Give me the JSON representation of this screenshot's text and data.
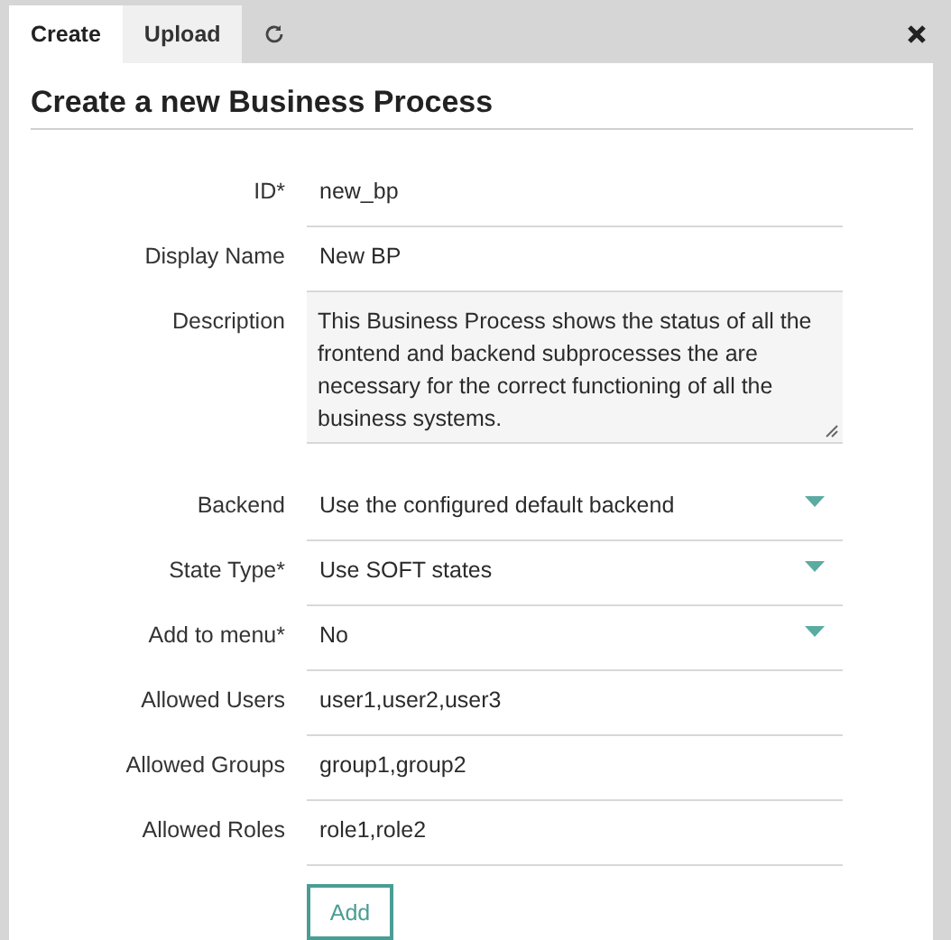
{
  "tabs": [
    {
      "label": "Create",
      "selected": true
    },
    {
      "label": "Upload",
      "selected": false
    }
  ],
  "heading": "Create a new Business Process",
  "fields": [
    {
      "kind": "text",
      "label": "ID*",
      "value": "new_bp"
    },
    {
      "kind": "text",
      "label": "Display Name",
      "value": "New BP"
    },
    {
      "kind": "textarea",
      "label": "Description",
      "value": "This Business Process shows the status of all the frontend and backend subprocesses the are necessary for the correct functioning of all the business systems."
    },
    {
      "kind": "select",
      "label": "Backend",
      "value": "Use the configured default backend"
    },
    {
      "kind": "select",
      "label": "State Type*",
      "value": "Use SOFT states"
    },
    {
      "kind": "select",
      "label": "Add to menu*",
      "value": "No"
    },
    {
      "kind": "text",
      "label": "Allowed Users",
      "value": "user1,user2,user3"
    },
    {
      "kind": "text",
      "label": "Allowed Groups",
      "value": "group1,group2"
    },
    {
      "kind": "text",
      "label": "Allowed Roles",
      "value": "role1,role2"
    }
  ],
  "submit": "Add"
}
